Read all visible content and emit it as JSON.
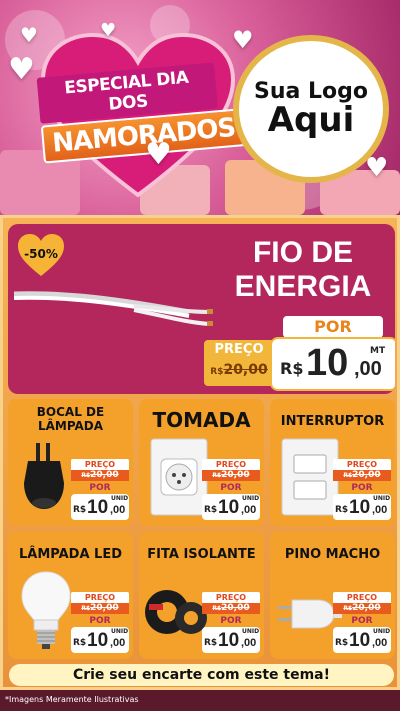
{
  "header": {
    "title_line1": "ESPECIAL DIA DOS",
    "title_line2": "NAMORADOS",
    "logo_line1": "Sua Logo",
    "logo_line2": "Aqui"
  },
  "featured": {
    "discount": "-50%",
    "name_line1": "FIO DE",
    "name_line2": "ENERGIA",
    "por_label": "POR",
    "preco_label": "PREÇO",
    "old_prefix": "R$",
    "old_price": "20,00",
    "currency": "R$",
    "price_int": "10",
    "price_dec": ",00",
    "unit": "MT"
  },
  "products": [
    {
      "name_line1": "BOCAL DE",
      "name_line2": "LÂMPADA",
      "icon": "lamp-socket-icon",
      "preco_label": "PREÇO",
      "old_prefix": "R$",
      "old_price": "20,00",
      "por_label": "POR",
      "currency": "R$",
      "price_int": "10",
      "price_dec": ",00",
      "unit": "UNID"
    },
    {
      "name_line1": "TOMADA",
      "name_line2": "",
      "icon": "power-outlet-icon",
      "preco_label": "PREÇO",
      "old_prefix": "R$",
      "old_price": "20,00",
      "por_label": "POR",
      "currency": "R$",
      "price_int": "10",
      "price_dec": ",00",
      "unit": "UNID"
    },
    {
      "name_line1": "INTERRUPTOR",
      "name_line2": "",
      "icon": "light-switch-icon",
      "preco_label": "PREÇO",
      "old_prefix": "R$",
      "old_price": "20,00",
      "por_label": "POR",
      "currency": "R$",
      "price_int": "10",
      "price_dec": ",00",
      "unit": "UNID"
    },
    {
      "name_line1": "LÂMPADA LED",
      "name_line2": "",
      "icon": "led-bulb-icon",
      "preco_label": "PREÇO",
      "old_prefix": "R$",
      "old_price": "20,00",
      "por_label": "POR",
      "currency": "R$",
      "price_int": "10",
      "price_dec": ",00",
      "unit": "UNID"
    },
    {
      "name_line1": "FITA ISOLANTE",
      "name_line2": "",
      "icon": "insulating-tape-icon",
      "preco_label": "PREÇO",
      "old_prefix": "R$",
      "old_price": "20,00",
      "por_label": "POR",
      "currency": "R$",
      "price_int": "10",
      "price_dec": ",00",
      "unit": "UNID"
    },
    {
      "name_line1": "PINO MACHO",
      "name_line2": "",
      "icon": "plug-icon",
      "preco_label": "PREÇO",
      "old_prefix": "R$",
      "old_price": "20,00",
      "por_label": "POR",
      "currency": "R$",
      "price_int": "10",
      "price_dec": ",00",
      "unit": "UNID"
    }
  ],
  "cta": "Crie seu encarte com este tema!",
  "footer": "*Imagens Meramente Ilustrativas",
  "colors": {
    "magenta": "#b3275d",
    "orange": "#f3a12b",
    "gold": "#f2b73a"
  }
}
